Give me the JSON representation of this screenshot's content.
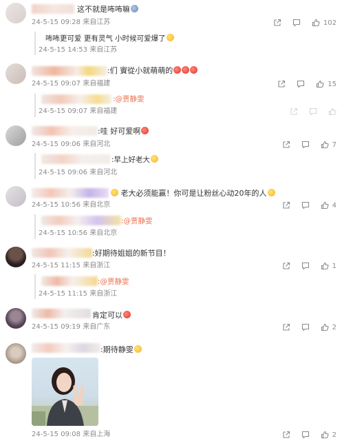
{
  "actions": {
    "share_label": "",
    "comment_label": ""
  },
  "comments": [
    {
      "text": "这不就是咘咘嘛",
      "time": "24-5-15 09:28",
      "location": "来自江苏",
      "likes": "102",
      "reply": {
        "text": "咘咘更可爱 更有灵气 小时候可爱爆了",
        "time": "24-5-15 14:53",
        "location": "来自江苏"
      }
    },
    {
      "text": ":们 賨從小就萌萌的",
      "time": "24-5-15 09:07",
      "location": "来自福建",
      "likes": "15",
      "reply": {
        "mention": ":@贾静雯",
        "time": "24-5-15 09:07",
        "location": "来自福建"
      }
    },
    {
      "text": ":哇 好可爱啊",
      "time": "24-5-15 09:06",
      "location": "来自河北",
      "likes": "7",
      "reply": {
        "text": ":早上好老大",
        "time": "24-5-15 09:06",
        "location": "来自河北"
      }
    },
    {
      "text": "老大必须能赢！你可是让粉丝心动20年的人",
      "time": "24-5-15 10:56",
      "location": "来自北京",
      "likes": "4",
      "reply": {
        "mention": ":@贾静雯",
        "time": "24-5-15 10:56",
        "location": "来自北京"
      }
    },
    {
      "text": ":好期待姐姐的新节目！",
      "time": "24-5-15 11:15",
      "location": "来自浙江",
      "likes": "1",
      "reply": {
        "mention": ":@贾静雯",
        "time": "24-5-15 11:15",
        "location": "来自浙江"
      }
    },
    {
      "text": "肯定可以",
      "time": "24-5-15 09:19",
      "location": "来自广东",
      "likes": "2"
    },
    {
      "text": ":期待静雯",
      "time": "24-5-15 09:08",
      "location": "来自上海",
      "likes": "2"
    }
  ]
}
